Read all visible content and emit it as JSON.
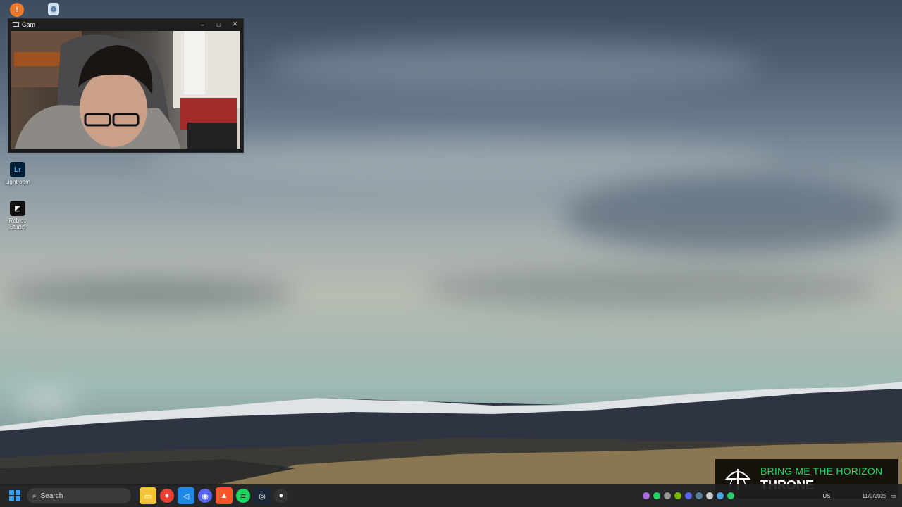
{
  "desktop": {
    "icons": [
      {
        "label": "",
        "icon": "app-icon"
      },
      {
        "label": "",
        "icon": "recycle-bin-icon"
      },
      {
        "label": "Lightroom",
        "icon": "lightroom-icon"
      },
      {
        "label": "Roblox Studio",
        "icon": "roblox-studio-icon"
      }
    ]
  },
  "cam_window": {
    "title": "Cam",
    "minimize": "–",
    "maximize": "□",
    "close": "✕"
  },
  "taskbar": {
    "search_placeholder": "Search",
    "apps": [
      "file-explorer-icon",
      "chrome-icon",
      "vscode-icon",
      "discord-icon",
      "brave-icon",
      "spotify-icon",
      "steam-icon",
      "obs-icon"
    ],
    "language": "US",
    "date": "11/9/2025"
  },
  "now_playing": {
    "artist": "BRING ME THE HORIZON",
    "title": "THRONE"
  },
  "colors": {
    "spotify_green": "#1ed760",
    "windows_blue": "#3aa0f5"
  }
}
